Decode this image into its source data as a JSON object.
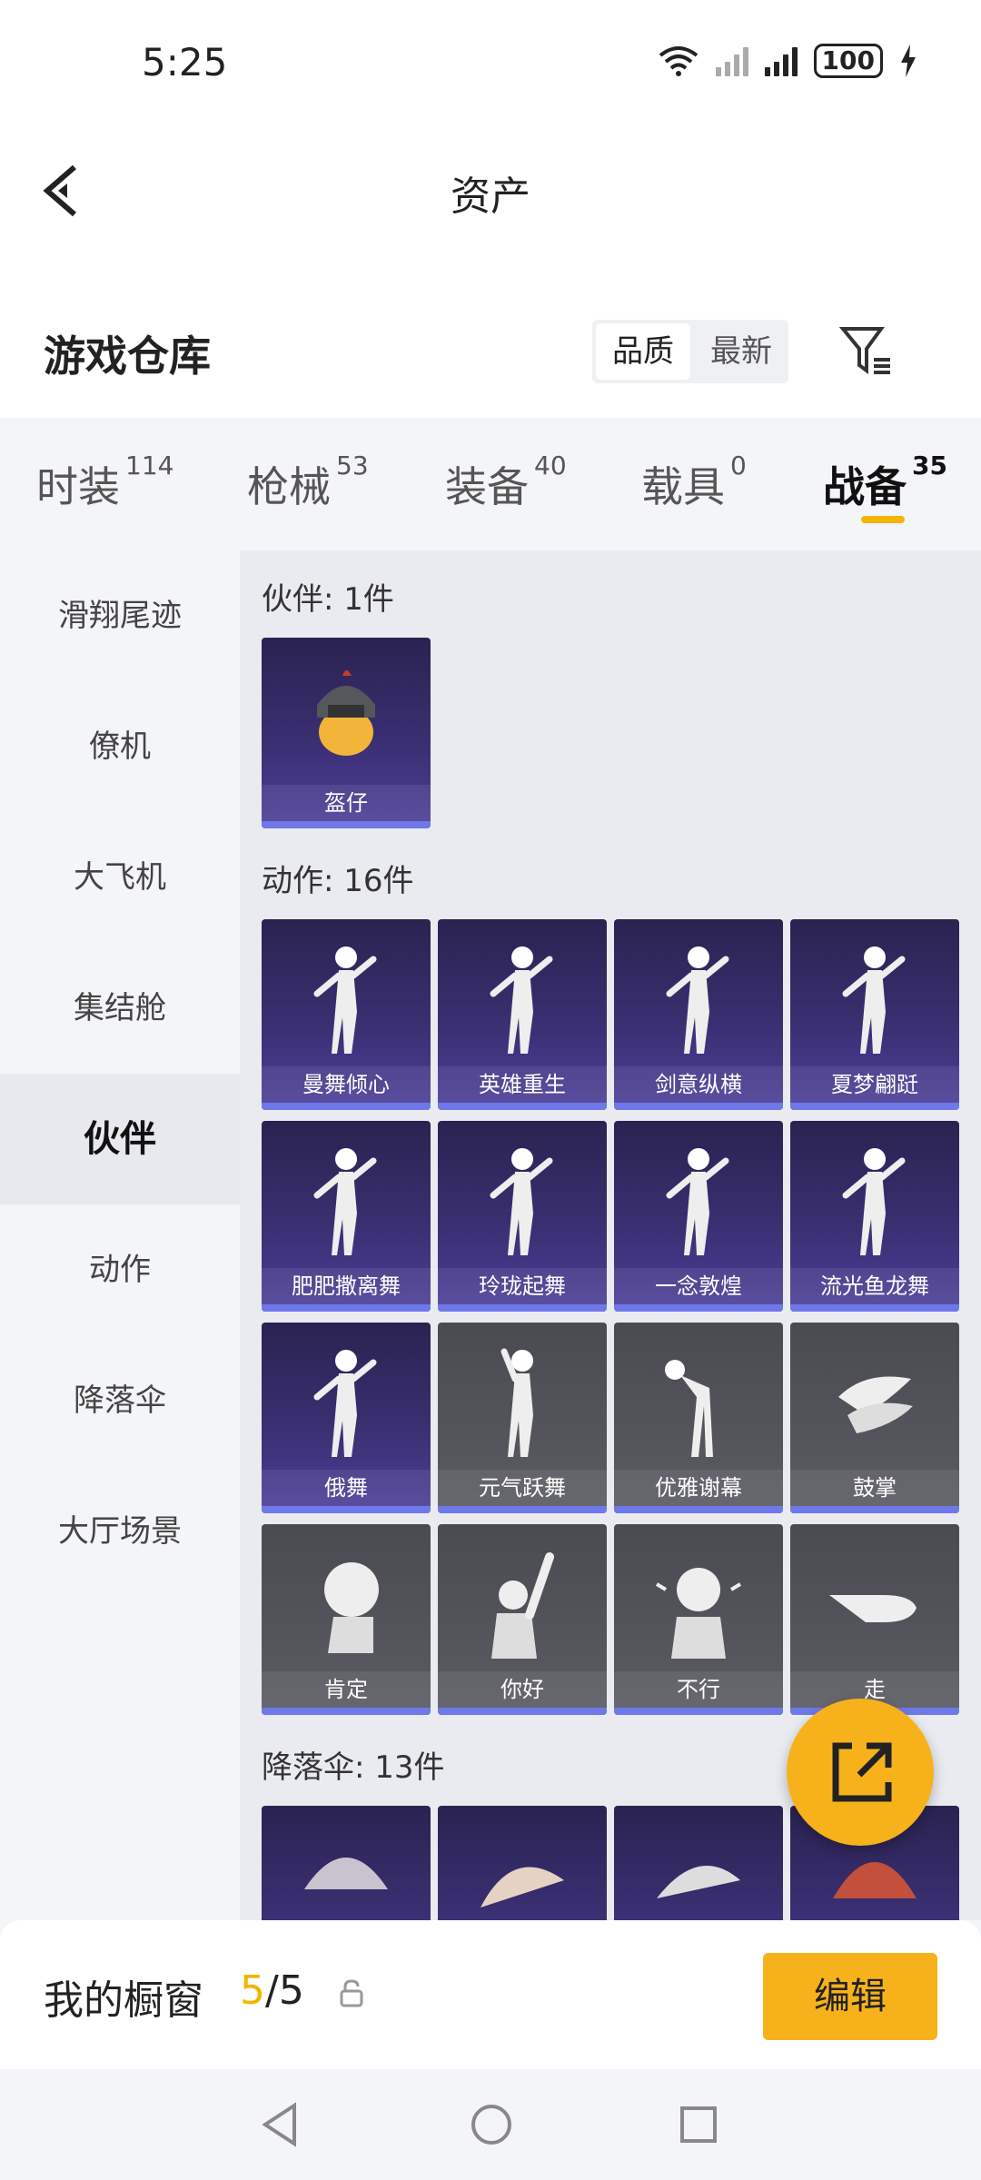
{
  "status": {
    "time": "5:25",
    "battery": "100"
  },
  "header": {
    "title": "资产"
  },
  "warehouse": {
    "title": "游戏仓库",
    "sort_options": [
      "品质",
      "最新"
    ]
  },
  "tabs": [
    {
      "label": "时装",
      "count": "114"
    },
    {
      "label": "枪械",
      "count": "53"
    },
    {
      "label": "装备",
      "count": "40"
    },
    {
      "label": "载具",
      "count": "0"
    },
    {
      "label": "战备",
      "count": "35"
    }
  ],
  "sidebar": {
    "items": [
      "滑翔尾迹",
      "僚机",
      "大飞机",
      "集结舱",
      "伙伴",
      "动作",
      "降落伞",
      "大厅场景"
    ]
  },
  "sections": {
    "partner": {
      "title": "伙伴: 1件",
      "items": [
        "盔仔"
      ]
    },
    "action": {
      "title": "动作: 16件",
      "items": [
        "曼舞倾心",
        "英雄重生",
        "剑意纵横",
        "夏梦翩跹",
        "肥肥撒离舞",
        "玲珑起舞",
        "一念敦煌",
        "流光鱼龙舞",
        "俄舞",
        "元气跃舞",
        "优雅谢幕",
        "鼓掌",
        "肯定",
        "你好",
        "不行",
        "走"
      ]
    },
    "parachute": {
      "title": "降落伞: 13件"
    }
  },
  "showcase": {
    "label": "我的橱窗",
    "current": "5",
    "total": "/5",
    "edit_label": "编辑"
  },
  "colors": {
    "accent": "#f7b21b",
    "card_purple": "#3a2f72",
    "card_gray": "#55565e"
  }
}
